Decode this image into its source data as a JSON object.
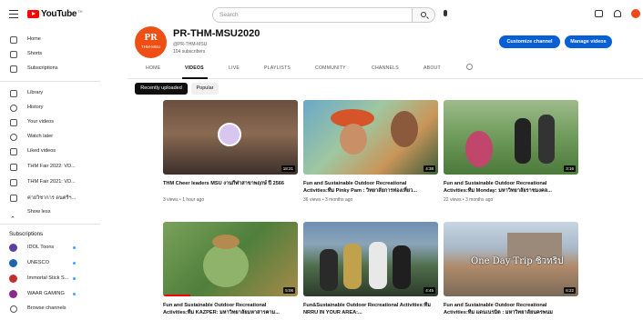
{
  "header": {
    "logo_text": "YouTube",
    "logo_sup": "TH",
    "search_placeholder": "Search"
  },
  "sidebar": {
    "main": [
      {
        "label": "Home",
        "icon": "home-icon"
      },
      {
        "label": "Shorts",
        "icon": "shorts-icon"
      },
      {
        "label": "Subscriptions",
        "icon": "subscriptions-icon"
      }
    ],
    "library": [
      {
        "label": "Library",
        "icon": "library-icon"
      },
      {
        "label": "History",
        "icon": "history-icon"
      },
      {
        "label": "Your videos",
        "icon": "your-videos-icon"
      },
      {
        "label": "Watch later",
        "icon": "watch-later-icon"
      },
      {
        "label": "Liked videos",
        "icon": "liked-icon"
      },
      {
        "label": "THM Fair 2022: VD...",
        "icon": "playlist-icon"
      },
      {
        "label": "THM Fair 2021: VD...",
        "icon": "playlist-icon"
      },
      {
        "label": "ค่ายวิชาการ ดนตรีฯ...",
        "icon": "playlist-icon"
      },
      {
        "label": "Show less",
        "icon": "chevron-up-icon"
      }
    ],
    "subscriptions_heading": "Subscriptions",
    "subscriptions": [
      {
        "label": "IDOL Toons",
        "color": "#5a3fa0"
      },
      {
        "label": "UNESCO",
        "color": "#1d64b0"
      },
      {
        "label": "Immortal Stick S...",
        "color": "#c03030"
      },
      {
        "label": "WAAR GAMING",
        "color": "#8a2a8a"
      },
      {
        "label": "Browse channels",
        "icon": "browse-channels-icon"
      }
    ]
  },
  "channel": {
    "avatar_line1": "PR",
    "avatar_line2": "THM-MSU",
    "name": "PR-THM-MSU2020",
    "handle": "@PR-THM-MSU",
    "subscribers": "104 subscribers",
    "customize_label": "Customize channel",
    "manage_label": "Manage videos",
    "accent": "#065fd4"
  },
  "tabs": [
    "HOME",
    "VIDEOS",
    "LIVE",
    "PLAYLISTS",
    "COMMUNITY",
    "CHANNELS",
    "ABOUT"
  ],
  "active_tab": "VIDEOS",
  "chips": {
    "recent": "Recently uploaded",
    "popular": "Popular"
  },
  "videos": [
    {
      "title": "THM Cheer leaders MSU งานกีฬาสาขาพฤกษ์ ปี 2566",
      "meta": "3 views • 1 hour ago",
      "duration": "18:21",
      "overlay": ""
    },
    {
      "title": "Fun and Sustainable Outdoor Recreational Activities:ทีม Pinky Pam : วิทยาลัยการท่องเที่ยว...",
      "meta": "36 views • 3 months ago",
      "duration": "4:38",
      "overlay": ""
    },
    {
      "title": "Fun and Sustainable Outdoor Recreational Activities:ทีม Monday: มหาวิทยาลัยราชมงคล...",
      "meta": "22 views • 3 months ago",
      "duration": "3:16",
      "overlay": ""
    },
    {
      "title": "Fun and Sustainable Outdoor Recreational Activities:ทีม KAZPER: มหาวิทยาลัยมหาสารคาม...",
      "meta": "",
      "duration": "5:06",
      "overlay": ""
    },
    {
      "title": "Fun&Sustainable Outdoor Recreational Activities:ทีม NRRU IN YOUR AREA:...",
      "meta": "",
      "duration": "4:45",
      "overlay": ""
    },
    {
      "title": "Fun and Sustainable Outdoor Recreational Activities:ทีม แดนเนรมิต : มหาวิทยาลัยนครพนม",
      "meta": "",
      "duration": "6:22",
      "overlay": "One Day Trip ชิวทริป"
    }
  ]
}
